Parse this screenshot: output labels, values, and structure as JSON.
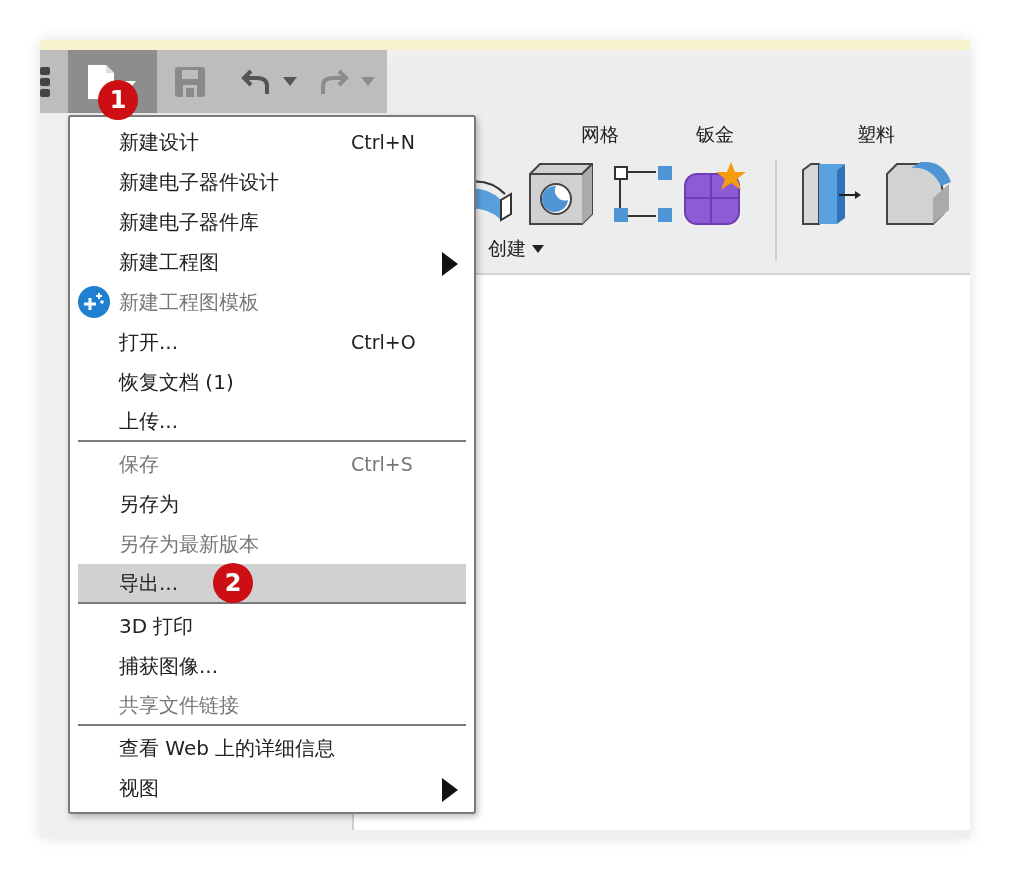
{
  "toolbar": {
    "file_badge": "1"
  },
  "ribbon": {
    "tabs": [
      "网格",
      "钣金",
      "塑料"
    ],
    "group_label": "创建"
  },
  "menu": {
    "items": [
      {
        "kind": "item",
        "label": "新建设计",
        "shortcut": "Ctrl+N",
        "disabled": false,
        "submenu": false,
        "selected": false,
        "divider_after": false
      },
      {
        "kind": "item",
        "label": "新建电子器件设计",
        "disabled": false,
        "submenu": false,
        "selected": false,
        "divider_after": false
      },
      {
        "kind": "item",
        "label": "新建电子器件库",
        "disabled": false,
        "submenu": false,
        "selected": false,
        "divider_after": false
      },
      {
        "kind": "item",
        "label": "新建工程图",
        "disabled": false,
        "submenu": true,
        "selected": false,
        "divider_after": false
      },
      {
        "kind": "new-template",
        "label": "新建工程图模板",
        "disabled": true,
        "submenu": false,
        "selected": false,
        "divider_after": false
      },
      {
        "kind": "item",
        "label": "打开...",
        "shortcut": "Ctrl+O",
        "disabled": false,
        "submenu": false,
        "selected": false,
        "divider_after": false
      },
      {
        "kind": "item",
        "label": "恢复文档 (1)",
        "disabled": false,
        "submenu": false,
        "selected": false,
        "divider_after": false
      },
      {
        "kind": "item",
        "label": "上传...",
        "disabled": false,
        "submenu": false,
        "selected": false,
        "divider_after": true
      },
      {
        "kind": "item",
        "label": "保存",
        "shortcut": "Ctrl+S",
        "disabled": true,
        "submenu": false,
        "selected": false,
        "divider_after": false
      },
      {
        "kind": "item",
        "label": "另存为",
        "disabled": false,
        "submenu": false,
        "selected": false,
        "divider_after": false
      },
      {
        "kind": "item",
        "label": "另存为最新版本",
        "disabled": true,
        "submenu": false,
        "selected": false,
        "divider_after": false
      },
      {
        "kind": "item",
        "label": "导出...",
        "badge": "2",
        "disabled": false,
        "submenu": false,
        "selected": true,
        "divider_after": true
      },
      {
        "kind": "item",
        "label": "3D 打印",
        "disabled": false,
        "submenu": false,
        "selected": false,
        "divider_after": false
      },
      {
        "kind": "item",
        "label": "捕获图像...",
        "disabled": false,
        "submenu": false,
        "selected": false,
        "divider_after": false
      },
      {
        "kind": "item",
        "label": "共享文件链接",
        "disabled": true,
        "submenu": false,
        "selected": false,
        "divider_after": true
      },
      {
        "kind": "item",
        "label": "查看 Web 上的详细信息",
        "disabled": false,
        "submenu": false,
        "selected": false,
        "divider_after": false
      },
      {
        "kind": "item",
        "label": "视图",
        "disabled": false,
        "submenu": true,
        "selected": false,
        "divider_after": false
      }
    ]
  }
}
